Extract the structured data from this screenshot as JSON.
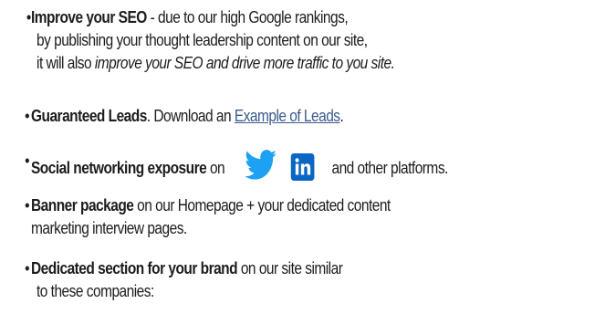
{
  "items": [
    {
      "bold": "Improve your SEO",
      "lines": [
        " - due to our high Google rankings,",
        "by publishing your thought leadership content on our site,",
        "it will also "
      ],
      "italic": "improve your SEO and drive more traffic to you site."
    },
    {
      "bold": "Guaranteed Leads",
      "text": ". Download an ",
      "link": "Example of Leads",
      "tail": "."
    },
    {
      "bold": "Social networking exposure",
      "text": " on",
      "tail": " and other platforms.",
      "icons": [
        "twitter-icon",
        "linkedin-icon"
      ],
      "icon_colors": {
        "twitter": "#1da1f2",
        "linkedin": "#0a66c2"
      }
    },
    {
      "bold": "Banner package",
      "text": " on our Homepage + your dedicated content",
      "line2": "marketing interview pages."
    },
    {
      "bold": "Dedicated section for your brand",
      "text": " on our site similar",
      "line2": "to these companies:"
    }
  ],
  "bullet": "•",
  "colors": {
    "text": "#1d1d1d",
    "link": "#3a5a8c"
  }
}
